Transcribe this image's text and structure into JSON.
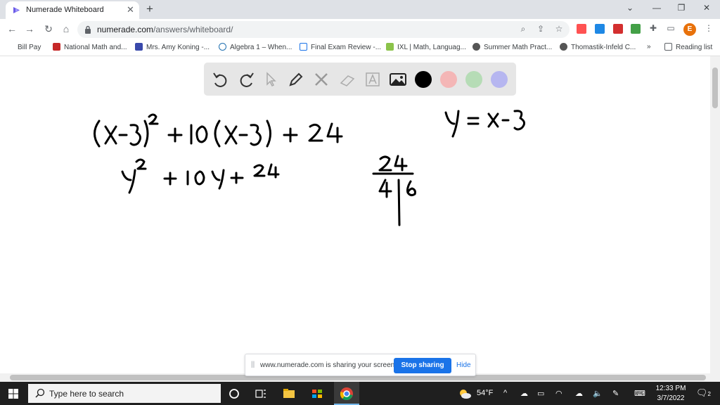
{
  "browser": {
    "tab_title": "Numerade Whiteboard",
    "tab_close": "✕",
    "new_tab": "+",
    "url_domain": "numerade.com",
    "url_path": "/answers/whiteboard/",
    "profile_initial": "E"
  },
  "bookmarks": [
    {
      "label": "Bill Pay",
      "icon": "apps-icon"
    },
    {
      "label": "National Math and...",
      "icon": "scissors-icon"
    },
    {
      "label": "Mrs. Amy Koning -...",
      "icon": "calendar-icon"
    },
    {
      "label": "Algebra 1 – When...",
      "icon": "wordpress-icon"
    },
    {
      "label": "Final Exam Review -...",
      "icon": "page-icon"
    },
    {
      "label": "IXL | Math, Languag...",
      "icon": "ixl-icon"
    },
    {
      "label": "Summer Math Pract...",
      "icon": "globe-icon"
    },
    {
      "label": "Thomastik-Infeld C...",
      "icon": "globe-icon"
    },
    {
      "label": "»",
      "icon": ""
    },
    {
      "label": "Reading list",
      "icon": "reading-list-icon"
    }
  ],
  "whiteboard": {
    "tools": [
      "undo-icon",
      "redo-icon",
      "pointer-icon",
      "pen-icon",
      "tools-icon",
      "eraser-icon",
      "text-icon",
      "image-icon"
    ],
    "colors": [
      "#000000",
      "#f4b6b6",
      "#b6dcb6",
      "#b6b6f0"
    ],
    "handwriting": {
      "line1": "(x-3)² + 10(x-3) + 24",
      "line2": "y² + 10y + 24",
      "substitution": "y = x-3",
      "factor_number": "24",
      "factor_left": "4",
      "factor_right": "6"
    }
  },
  "share_bar": {
    "grip": "||",
    "message": "www.numerade.com is sharing your screen.",
    "stop_label": "Stop sharing",
    "hide_label": "Hide"
  },
  "taskbar": {
    "search_placeholder": "Type here to search",
    "weather": "54°F",
    "time": "12:33 PM",
    "date": "3/7/2022",
    "notification_count": "2"
  }
}
